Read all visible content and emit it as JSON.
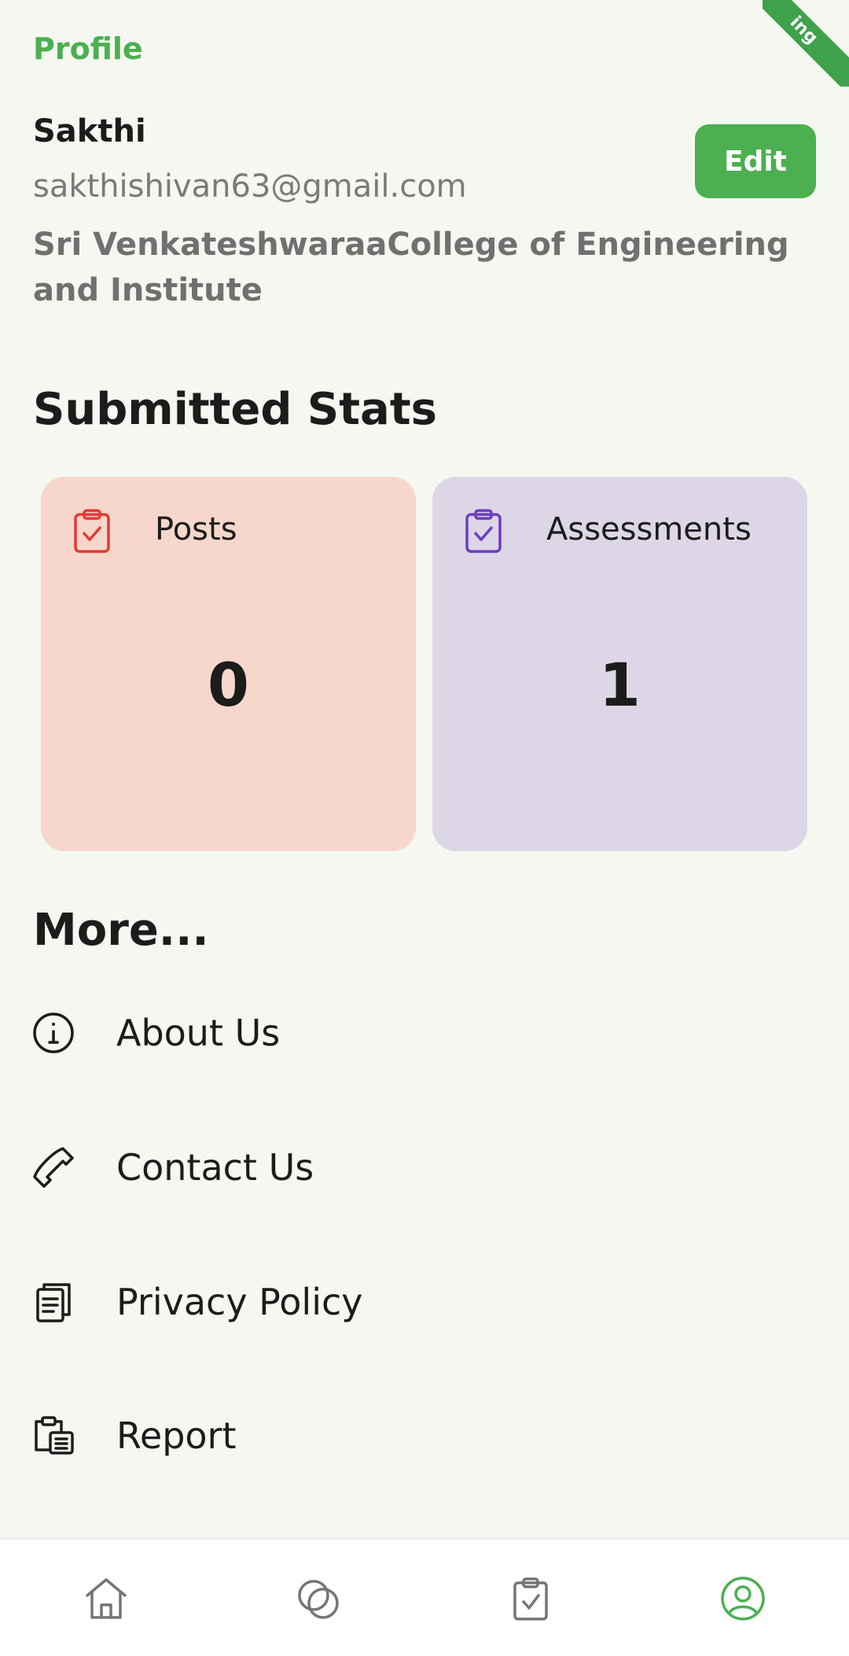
{
  "debug_banner": "ing",
  "app_title": "Profile",
  "user": {
    "name": "Sakthi",
    "email": "sakthishivan63@gmail.com",
    "college": "Sri VenkateshwaraaCollege of Engineering and Institute"
  },
  "edit_label": "Edit",
  "stats": {
    "title": "Submitted Stats",
    "cards": [
      {
        "label": "Posts",
        "value": "0",
        "icon": "clipboard-check-icon",
        "bg": "#f7d7cb",
        "icon_color": "#e53935"
      },
      {
        "label": "Assessments",
        "value": "1",
        "icon": "clipboard-check-icon",
        "bg": "#ddd6e6",
        "icon_color": "#6a3fc2"
      }
    ]
  },
  "more": {
    "title": "More...",
    "items": [
      {
        "label": "About Us",
        "icon": "info-icon"
      },
      {
        "label": "Contact Us",
        "icon": "phone-icon"
      },
      {
        "label": "Privacy Policy",
        "icon": "document-icon"
      },
      {
        "label": "Report",
        "icon": "report-icon"
      }
    ]
  },
  "bottom_nav": {
    "items": [
      {
        "name": "home",
        "icon": "home-icon"
      },
      {
        "name": "explore",
        "icon": "circles-icon"
      },
      {
        "name": "assessments",
        "icon": "clipboard-check-icon"
      },
      {
        "name": "profile",
        "icon": "profile-icon",
        "active": true
      }
    ],
    "active_color": "#4caf50",
    "inactive_color": "#757575"
  }
}
